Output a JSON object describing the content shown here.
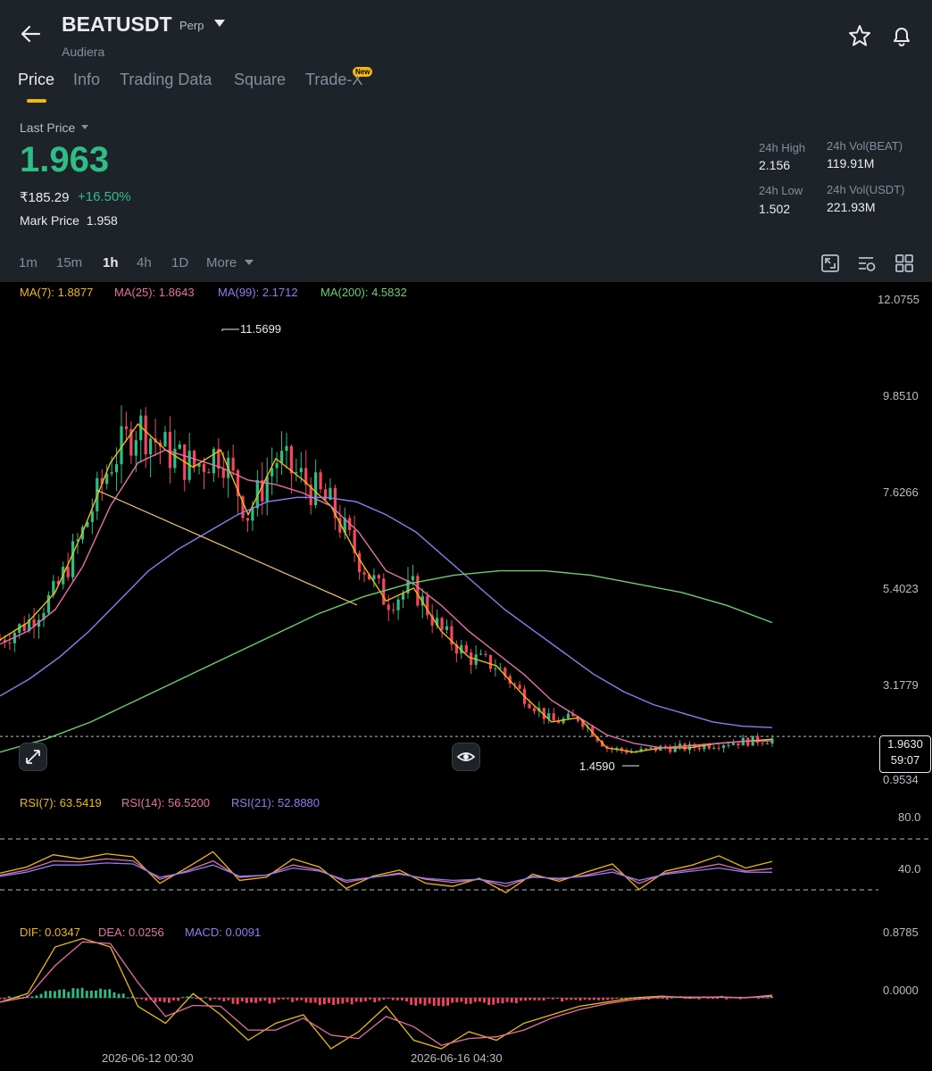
{
  "header": {
    "symbol": "BEATUSDT",
    "contract_type": "Perp",
    "subtitle": "Audiera",
    "icons": [
      "back-arrow-icon",
      "dropdown-caret-icon",
      "star-icon",
      "bell-icon"
    ]
  },
  "tabs": [
    {
      "label": "Price",
      "active": true
    },
    {
      "label": "Info",
      "active": false
    },
    {
      "label": "Trading Data",
      "active": false
    },
    {
      "label": "Square",
      "active": false
    },
    {
      "label": "Trade-X",
      "active": false
    }
  ],
  "new_badge": "New",
  "price": {
    "last_price_label": "Last Price",
    "last_price": "1.963",
    "inr_price": "₹185.29",
    "change": "+16.50%",
    "mark_price_label": "Mark Price",
    "mark_price": "1.958"
  },
  "stats": {
    "high_label": "24h High",
    "high": "2.156",
    "low_label": "24h Low",
    "low": "1.502",
    "vol_beat_label": "24h Vol(BEAT)",
    "vol_beat": "119.91M",
    "vol_usdt_label": "24h Vol(USDT)",
    "vol_usdt": "221.93M"
  },
  "intervals": [
    {
      "label": "1m",
      "active": false
    },
    {
      "label": "15m",
      "active": false
    },
    {
      "label": "1h",
      "active": true
    },
    {
      "label": "4h",
      "active": false
    },
    {
      "label": "1D",
      "active": false
    },
    {
      "label": "More",
      "active": false
    }
  ],
  "colors": {
    "up": "#2ebd85",
    "down": "#f6465d",
    "ma7": "#f0b90b",
    "ma25": "#e76fa9",
    "ma99": "#8a7ff0",
    "ma200": "#67d06c",
    "accent": "#f0b90b"
  },
  "ma_legend": {
    "ma7": "MA(7): 1.8877",
    "ma25": "MA(25): 1.8643",
    "ma99": "MA(99): 2.1712",
    "ma200": "MA(200): 4.5832"
  },
  "rsi_legend": {
    "rsi7": "RSI(7): 63.5419",
    "rsi14": "RSI(14): 56.5200",
    "rsi21": "RSI(21): 52.8880"
  },
  "macd_legend": {
    "dif": "DIF: 0.0347",
    "dea": "DEA: 0.0256",
    "macd": "MACD: 0.0091"
  },
  "price_axis": [
    "12.0755",
    "9.8510",
    "7.6266",
    "5.4023",
    "3.1779",
    "0.9534"
  ],
  "rsi_axis": [
    "80.0",
    "40.0"
  ],
  "macd_axis": [
    "0.8785",
    "0.0000"
  ],
  "chart_high": "11.5699",
  "chart_low": "1.4590",
  "current_tag": {
    "price": "1.9630",
    "countdown": "59:07"
  },
  "dates": [
    "2026-06-12 00:30",
    "2026-06-16 04:30"
  ],
  "chart_data": {
    "type": "line",
    "interval": "1h",
    "ylim": [
      0.9534,
      12.0755
    ],
    "tick_labels_y": [
      "12.0755",
      "9.8510",
      "7.6266",
      "5.4023",
      "3.1779",
      "0.9534"
    ],
    "tick_labels_x": [
      "2026-06-12 00:30",
      "2026-06-16 04:30"
    ],
    "series": [
      {
        "name": "MA(7)",
        "values": [
          4.2,
          4.6,
          5.3,
          6.7,
          8.3,
          9.2,
          8.6,
          8.2,
          8.6,
          7.1,
          8.4,
          7.9,
          7.3,
          6.1,
          5.1,
          5.4,
          4.4,
          3.8,
          3.6,
          2.9,
          2.3,
          2.4,
          1.7,
          1.6,
          1.7,
          1.7,
          1.8,
          1.85,
          1.9
        ]
      },
      {
        "name": "MA(25)",
        "values": [
          4.1,
          4.4,
          4.9,
          5.9,
          7.3,
          8.3,
          8.6,
          8.4,
          8.2,
          7.9,
          7.8,
          7.6,
          7.3,
          6.7,
          5.8,
          5.5,
          5.0,
          4.4,
          3.9,
          3.4,
          2.8,
          2.4,
          2.0,
          1.8,
          1.7,
          1.75,
          1.8,
          1.85,
          1.86
        ]
      },
      {
        "name": "MA(99)",
        "values": [
          2.9,
          3.3,
          3.8,
          4.4,
          5.1,
          5.8,
          6.3,
          6.7,
          7.1,
          7.4,
          7.5,
          7.5,
          7.4,
          7.1,
          6.7,
          6.1,
          5.5,
          4.9,
          4.4,
          3.9,
          3.4,
          3.0,
          2.7,
          2.5,
          2.3,
          2.2,
          2.17
        ]
      },
      {
        "name": "MA(200)",
        "values": [
          1.6,
          1.9,
          2.3,
          2.8,
          3.3,
          3.8,
          4.3,
          4.8,
          5.2,
          5.5,
          5.7,
          5.8,
          5.8,
          5.7,
          5.5,
          5.3,
          5.0,
          4.6
        ]
      },
      {
        "name": "RSI(7)",
        "values": [
          52,
          58,
          70,
          66,
          71,
          68,
          42,
          57,
          73,
          45,
          48,
          66,
          58,
          37,
          49,
          55,
          42,
          39,
          47,
          33,
          51,
          44,
          53,
          61,
          36,
          54,
          60,
          69,
          57,
          63.5
        ]
      },
      {
        "name": "RSI(14)",
        "values": [
          50,
          55,
          64,
          63,
          66,
          64,
          46,
          54,
          64,
          48,
          50,
          60,
          55,
          43,
          48,
          52,
          46,
          43,
          46,
          39,
          49,
          46,
          50,
          56,
          42,
          52,
          56,
          61,
          54,
          56.5
        ]
      },
      {
        "name": "RSI(21)",
        "values": [
          49,
          53,
          60,
          60,
          62,
          61,
          48,
          53,
          60,
          49,
          50,
          57,
          54,
          45,
          48,
          51,
          47,
          45,
          46,
          42,
          48,
          47,
          49,
          53,
          45,
          51,
          54,
          57,
          53,
          52.9
        ]
      }
    ],
    "annotations": [
      {
        "label": "11.5699",
        "type": "high"
      },
      {
        "label": "1.4590",
        "type": "low"
      }
    ]
  }
}
